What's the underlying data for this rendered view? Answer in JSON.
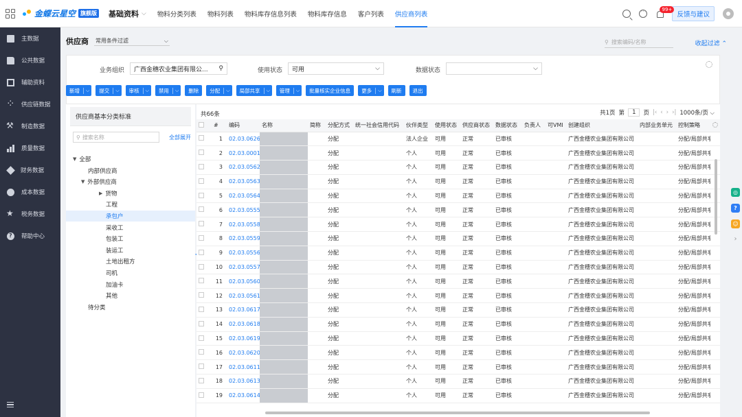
{
  "topbar": {
    "brand": "金蝶云星空",
    "brand_sub": "",
    "edition_badge": "旗舰版",
    "module": "基础资料",
    "tabs": [
      "物料分类列表",
      "物料列表",
      "物料库存信息列表",
      "物料库存信息",
      "客户列表",
      "供应商列表"
    ],
    "active_tab": "供应商列表",
    "notif_badge": "99+",
    "feedback_label": "反馈与建议"
  },
  "sidebar": {
    "items": [
      "主数据",
      "公共数据",
      "辅助资料",
      "供应链数据",
      "制造数据",
      "质量数据",
      "财务数据",
      "成本数据",
      "税务数据",
      "帮助中心"
    ]
  },
  "header": {
    "title": "供应商",
    "filter_scheme": "常用条件过滤",
    "search_placeholder": "搜索编码/名称",
    "collapse_label": "收起过滤"
  },
  "filters": {
    "org_label": "业务组织",
    "org_value": "广西金穗农业集团有限公...",
    "use_status_label": "使用状态",
    "use_status_value": "可用",
    "data_status_label": "数据状态",
    "data_status_value": ""
  },
  "toolbar": {
    "buttons": [
      {
        "label": "新增",
        "dropdown": true
      },
      {
        "label": "提交",
        "dropdown": true
      },
      {
        "label": "审核",
        "dropdown": true
      },
      {
        "label": "禁用",
        "dropdown": true
      },
      {
        "label": "删除",
        "dropdown": false
      },
      {
        "label": "分配",
        "dropdown": true
      },
      {
        "label": "局部共享",
        "dropdown": true
      },
      {
        "label": "管理",
        "dropdown": true
      },
      {
        "label": "批量核实企业信息",
        "dropdown": false
      },
      {
        "label": "更多",
        "dropdown": true
      },
      {
        "label": "刷新",
        "dropdown": false
      },
      {
        "label": "退出",
        "dropdown": false
      }
    ]
  },
  "tree": {
    "title": "供应商基本分类标准",
    "search_placeholder": "搜索名称",
    "expand_all": "全部展开",
    "nodes": [
      {
        "label": "全部",
        "level": 0,
        "caret": "▼"
      },
      {
        "label": "内部供应商",
        "level": 1,
        "caret": ""
      },
      {
        "label": "外部供应商",
        "level": 1,
        "caret": "▼"
      },
      {
        "label": "货物",
        "level": 2,
        "caret": "▶"
      },
      {
        "label": "工程",
        "level": 2,
        "caret": ""
      },
      {
        "label": "承包户",
        "level": 2,
        "caret": "",
        "selected": true
      },
      {
        "label": "采收工",
        "level": 2,
        "caret": ""
      },
      {
        "label": "包装工",
        "level": 2,
        "caret": ""
      },
      {
        "label": "装运工",
        "level": 2,
        "caret": ""
      },
      {
        "label": "土地出租方",
        "level": 2,
        "caret": ""
      },
      {
        "label": "司机",
        "level": 2,
        "caret": ""
      },
      {
        "label": "加油卡",
        "level": 2,
        "caret": ""
      },
      {
        "label": "其他",
        "level": 2,
        "caret": ""
      },
      {
        "label": "待分类",
        "level": 1,
        "caret": ""
      }
    ]
  },
  "table": {
    "total_label": "共66条",
    "pager": {
      "pages_text": "共1页",
      "page_prefix": "第",
      "page_value": "1",
      "page_suffix": "页",
      "page_size": "1000条/页"
    },
    "columns": [
      "#",
      "编码",
      "名称",
      "简称",
      "分配方式",
      "统一社会信用代码",
      "伙伴类型",
      "使用状态",
      "供应商状态",
      "数据状态",
      "负责人",
      "可VMI",
      "创建组织",
      "内部业务单元",
      "控制策略"
    ],
    "rows": [
      [
        "1",
        "02.03.0626",
        "",
        "",
        "分配",
        "",
        "法人企业",
        "可用",
        "正常",
        "已审核",
        "",
        "",
        "广西金穗农业集团有限公司",
        "",
        "分配/局部共享"
      ],
      [
        "2",
        "02.03.0001",
        "",
        "",
        "分配",
        "",
        "个人",
        "可用",
        "正常",
        "已审核",
        "",
        "",
        "广西金穗农业集团有限公司",
        "",
        "分配/局部共享"
      ],
      [
        "3",
        "02.03.0562",
        "",
        "",
        "分配",
        "",
        "个人",
        "可用",
        "正常",
        "已审核",
        "",
        "",
        "广西金穗农业集团有限公司",
        "",
        "分配/局部共享"
      ],
      [
        "4",
        "02.03.0563",
        "",
        "",
        "分配",
        "",
        "个人",
        "可用",
        "正常",
        "已审核",
        "",
        "",
        "广西金穗农业集团有限公司",
        "",
        "分配/局部共享"
      ],
      [
        "5",
        "02.03.0564",
        "",
        "",
        "分配",
        "",
        "个人",
        "可用",
        "正常",
        "已审核",
        "",
        "",
        "广西金穗农业集团有限公司",
        "",
        "分配/局部共享"
      ],
      [
        "6",
        "02.03.0555",
        "",
        "",
        "分配",
        "",
        "个人",
        "可用",
        "正常",
        "已审核",
        "",
        "",
        "广西金穗农业集团有限公司",
        "",
        "分配/局部共享"
      ],
      [
        "7",
        "02.03.0558",
        "",
        "",
        "分配",
        "",
        "个人",
        "可用",
        "正常",
        "已审核",
        "",
        "",
        "广西金穗农业集团有限公司",
        "",
        "分配/局部共享"
      ],
      [
        "8",
        "02.03.0559",
        "",
        "",
        "分配",
        "",
        "个人",
        "可用",
        "正常",
        "已审核",
        "",
        "",
        "广西金穗农业集团有限公司",
        "",
        "分配/局部共享"
      ],
      [
        "9",
        "02.03.0556",
        "",
        "",
        "分配",
        "",
        "个人",
        "可用",
        "正常",
        "已审核",
        "",
        "",
        "广西金穗农业集团有限公司",
        "",
        "分配/局部共享"
      ],
      [
        "10",
        "02.03.0557",
        "",
        "",
        "分配",
        "",
        "个人",
        "可用",
        "正常",
        "已审核",
        "",
        "",
        "广西金穗农业集团有限公司",
        "",
        "分配/局部共享"
      ],
      [
        "11",
        "02.03.0560",
        "",
        "",
        "分配",
        "",
        "个人",
        "可用",
        "正常",
        "已审核",
        "",
        "",
        "广西金穗农业集团有限公司",
        "",
        "分配/局部共享"
      ],
      [
        "12",
        "02.03.0561",
        "",
        "",
        "分配",
        "",
        "个人",
        "可用",
        "正常",
        "已审核",
        "",
        "",
        "广西金穗农业集团有限公司",
        "",
        "分配/局部共享"
      ],
      [
        "13",
        "02.03.0617",
        "",
        "",
        "分配",
        "",
        "个人",
        "可用",
        "正常",
        "已审核",
        "",
        "",
        "广西金穗农业集团有限公司",
        "",
        "分配/局部共享"
      ],
      [
        "14",
        "02.03.0618",
        "",
        "",
        "分配",
        "",
        "个人",
        "可用",
        "正常",
        "已审核",
        "",
        "",
        "广西金穗农业集团有限公司",
        "",
        "分配/局部共享"
      ],
      [
        "15",
        "02.03.0619",
        "",
        "",
        "分配",
        "",
        "个人",
        "可用",
        "正常",
        "已审核",
        "",
        "",
        "广西金穗农业集团有限公司",
        "",
        "分配/局部共享"
      ],
      [
        "16",
        "02.03.0620",
        "",
        "",
        "分配",
        "",
        "个人",
        "可用",
        "正常",
        "已审核",
        "",
        "",
        "广西金穗农业集团有限公司",
        "",
        "分配/局部共享"
      ],
      [
        "17",
        "02.03.0611",
        "",
        "",
        "分配",
        "",
        "个人",
        "可用",
        "正常",
        "已审核",
        "",
        "",
        "广西金穗农业集团有限公司",
        "",
        "分配/局部共享"
      ],
      [
        "18",
        "02.03.0613",
        "",
        "",
        "分配",
        "",
        "个人",
        "可用",
        "正常",
        "已审核",
        "",
        "",
        "广西金穗农业集团有限公司",
        "",
        "分配/局部共享"
      ],
      [
        "19",
        "02.03.0614",
        "",
        "",
        "分配",
        "",
        "个人",
        "可用",
        "正常",
        "已审核",
        "",
        "",
        "广西金穗农业集团有限公司",
        "",
        "分配/局部共享"
      ]
    ]
  },
  "colors": {
    "accent": "#1f7cf0",
    "sidebar_bg": "#2d3242",
    "float_green": "#16b18a",
    "float_blue": "#2f7ef5",
    "float_orange": "#f6a623"
  }
}
